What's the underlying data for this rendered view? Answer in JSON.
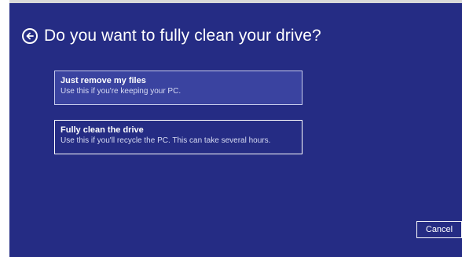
{
  "header": {
    "title": "Do you want to fully clean your drive?",
    "back_icon": "arrow-left-circle-icon"
  },
  "options": [
    {
      "title": "Just remove my files",
      "description": "Use this if you're keeping your PC.",
      "selected": true
    },
    {
      "title": "Fully clean the drive",
      "description": "Use this if you'll recycle the PC. This can take several hours.",
      "selected": false
    }
  ],
  "footer": {
    "cancel_label": "Cancel"
  },
  "colors": {
    "background": "#252c84",
    "selected_option": "#3a43a0",
    "text": "#ffffff"
  }
}
